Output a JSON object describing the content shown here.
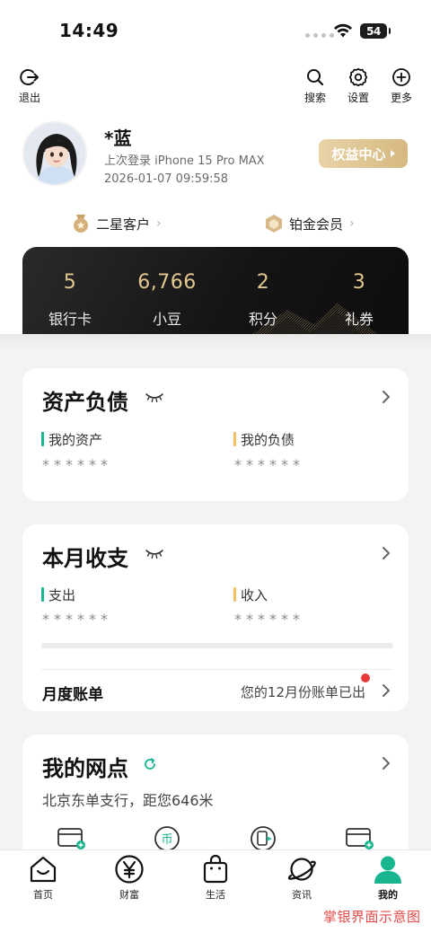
{
  "status_bar": {
    "time": "14:49",
    "battery": "54"
  },
  "top_bar": {
    "logout_label": "退出",
    "search_label": "搜索",
    "settings_label": "设置",
    "more_label": "更多"
  },
  "profile": {
    "name": "*蓝",
    "last_login": "上次登录 iPhone 15 Pro MAX",
    "login_time": "2026-01-07 09:59:58",
    "rights_button": "权益中心"
  },
  "tiers": {
    "customer_level": "二星客户",
    "member_level": "铂金会员"
  },
  "stats": [
    {
      "value": "5",
      "label": "银行卡"
    },
    {
      "value": "6,766",
      "label": "小豆"
    },
    {
      "value": "2",
      "label": "积分"
    },
    {
      "value": "3",
      "label": "礼券"
    }
  ],
  "assets_card": {
    "title": "资产负债",
    "assets_label": "我的资产",
    "assets_value": "******",
    "liabilities_label": "我的负债",
    "liabilities_value": "******"
  },
  "monthly_card": {
    "title": "本月收支",
    "expense_label": "支出",
    "expense_value": "******",
    "income_label": "收入",
    "income_value": "******",
    "bill_title": "月度账单",
    "bill_status": "您的12月份账单已出"
  },
  "branch_card": {
    "title": "我的网点",
    "address": "北京东单支行，距您646米"
  },
  "bottom_nav": [
    {
      "label": "首页",
      "icon": "home-icon"
    },
    {
      "label": "财富",
      "icon": "yen-icon"
    },
    {
      "label": "生活",
      "icon": "shopping-bag-icon"
    },
    {
      "label": "资讯",
      "icon": "planet-icon"
    },
    {
      "label": "我的",
      "icon": "person-icon"
    }
  ],
  "watermark": "掌银界面示意图",
  "colors": {
    "accent_green": "#19b58f",
    "gold": "#e3c790",
    "alert_red": "#e83a3a"
  }
}
